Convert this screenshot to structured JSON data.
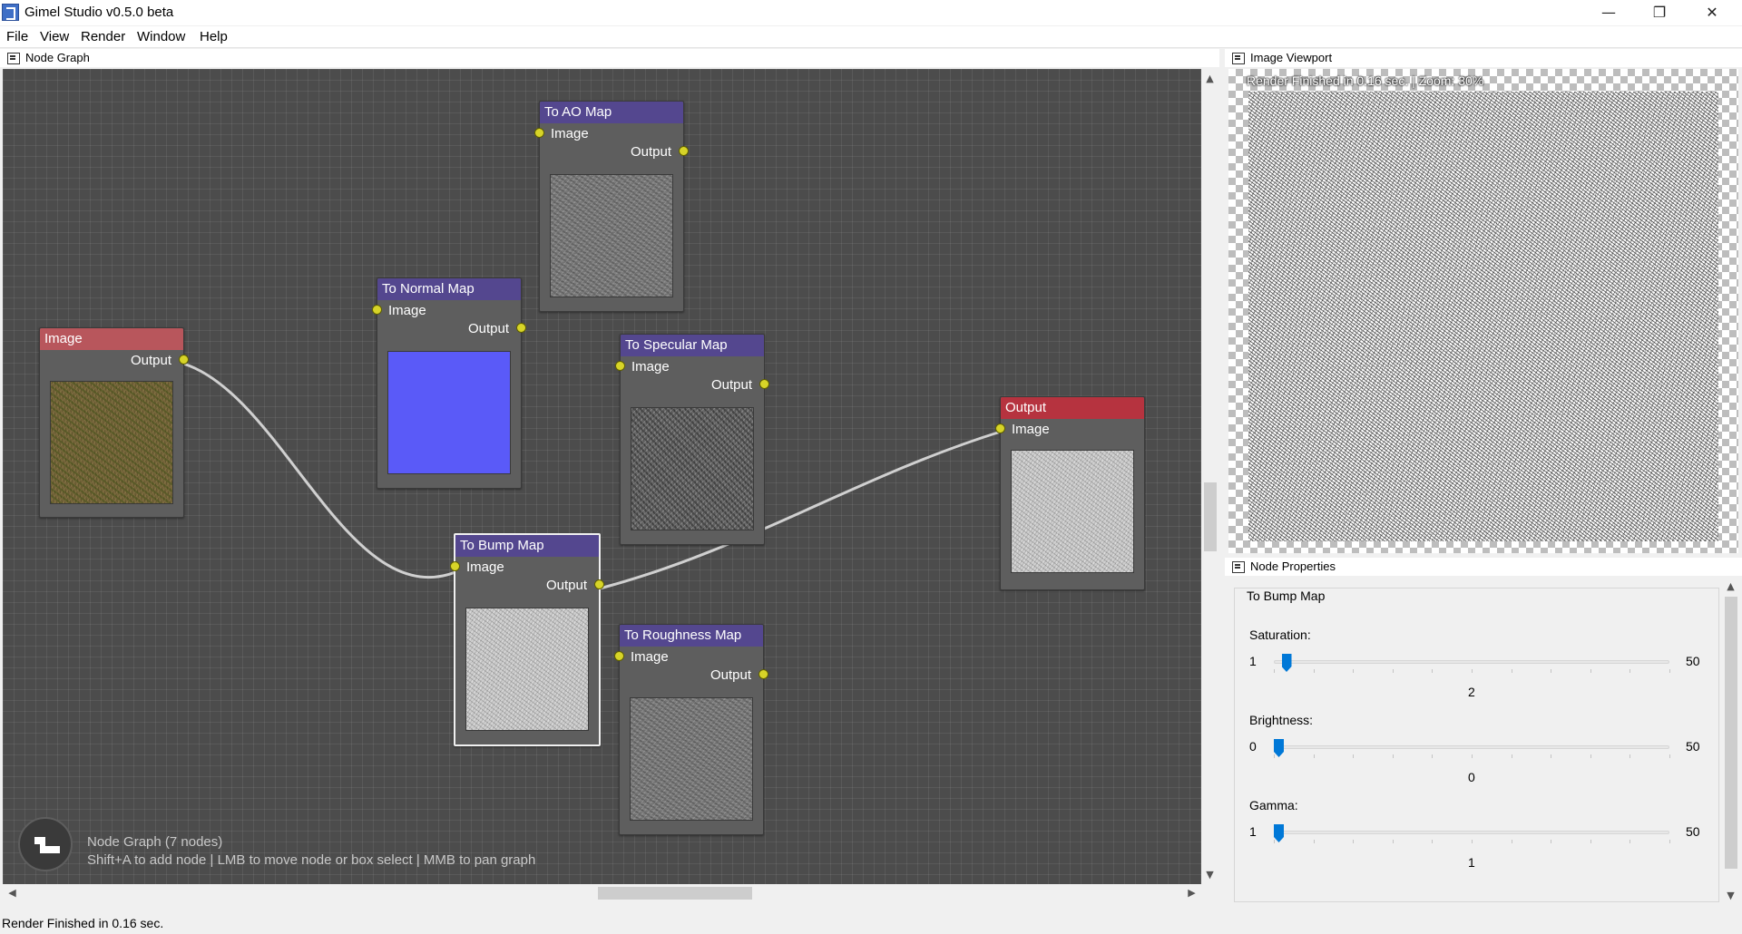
{
  "window": {
    "title": "Gimel Studio v0.5.0 beta",
    "minimize_glyph": "—",
    "maximize_glyph": "❐",
    "close_glyph": "✕"
  },
  "menu": [
    "File",
    "View",
    "Render",
    "Window",
    "Help"
  ],
  "panels": {
    "node_graph": "Node Graph",
    "image_viewport": "Image Viewport",
    "node_properties": "Node Properties"
  },
  "nodes": {
    "image": {
      "title": "Image",
      "output": "Output"
    },
    "normal": {
      "title": "To Normal Map",
      "input": "Image",
      "output": "Output"
    },
    "ao": {
      "title": "To AO Map",
      "input": "Image",
      "output": "Output"
    },
    "specular": {
      "title": "To Specular Map",
      "input": "Image",
      "output": "Output"
    },
    "bump": {
      "title": "To Bump Map",
      "input": "Image",
      "output": "Output"
    },
    "roughness": {
      "title": "To Roughness Map",
      "input": "Image",
      "output": "Output"
    },
    "output": {
      "title": "Output",
      "input": "Image"
    }
  },
  "graph_info": {
    "count": "Node Graph (7 nodes)",
    "hint": "Shift+A to add node | LMB to move node or box select | MMB to pan graph"
  },
  "viewport": {
    "status": "Render Finished in 0.16 sec. | Zoom: 30%"
  },
  "properties": {
    "node_name": "To Bump Map",
    "sliders": [
      {
        "label": "Saturation:",
        "min": "1",
        "max": "50",
        "value": "2",
        "fraction": 0.02
      },
      {
        "label": "Brightness:",
        "min": "0",
        "max": "50",
        "value": "0",
        "fraction": 0.0
      },
      {
        "label": "Gamma:",
        "min": "1",
        "max": "50",
        "value": "1",
        "fraction": 0.0
      }
    ]
  },
  "statusbar": "Render Finished in 0.16 sec.",
  "colors": {
    "node_header_purple": "#54478f",
    "node_header_red": "#b6333f",
    "socket_yellow": "#d7d428",
    "slider_blue": "#0078d7"
  }
}
